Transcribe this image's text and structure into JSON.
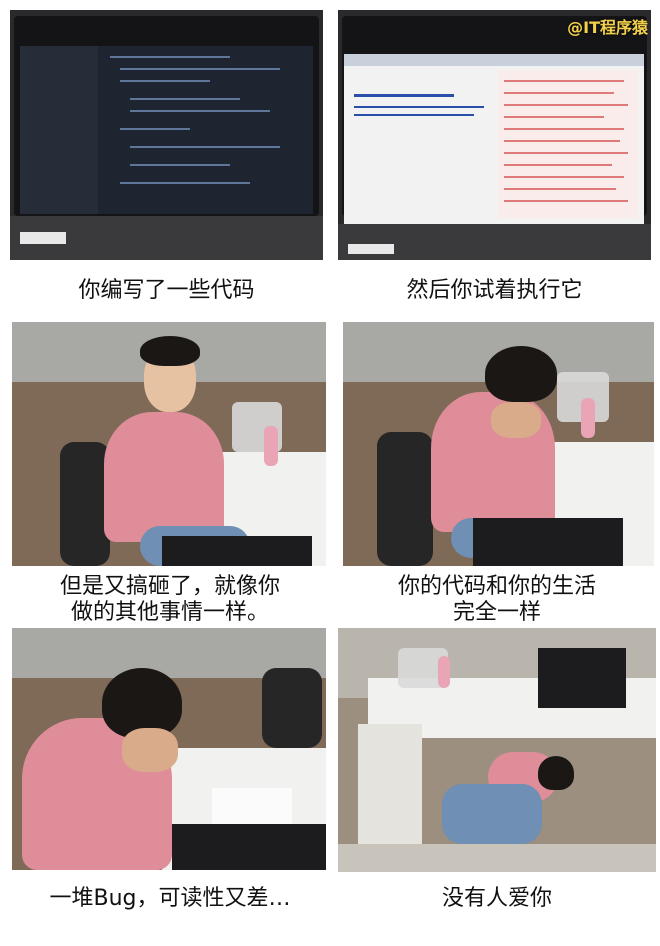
{
  "watermark": "@IT程序猿",
  "panels": [
    {
      "caption": "你编写了一些代码"
    },
    {
      "caption": "然后你试着执行它"
    },
    {
      "caption_line1": "但是又搞砸了，就像你",
      "caption_line2": "做的其他事情一样。"
    },
    {
      "caption_line1": "你的代码和你的生活",
      "caption_line2": "完全一样"
    },
    {
      "caption": "一堆Bug，可读性又差…"
    },
    {
      "caption": "没有人爱你"
    }
  ],
  "colors": {
    "shirt": "#df8d99",
    "desk": "#f1f1ef",
    "watermark": "#f3d14a"
  }
}
